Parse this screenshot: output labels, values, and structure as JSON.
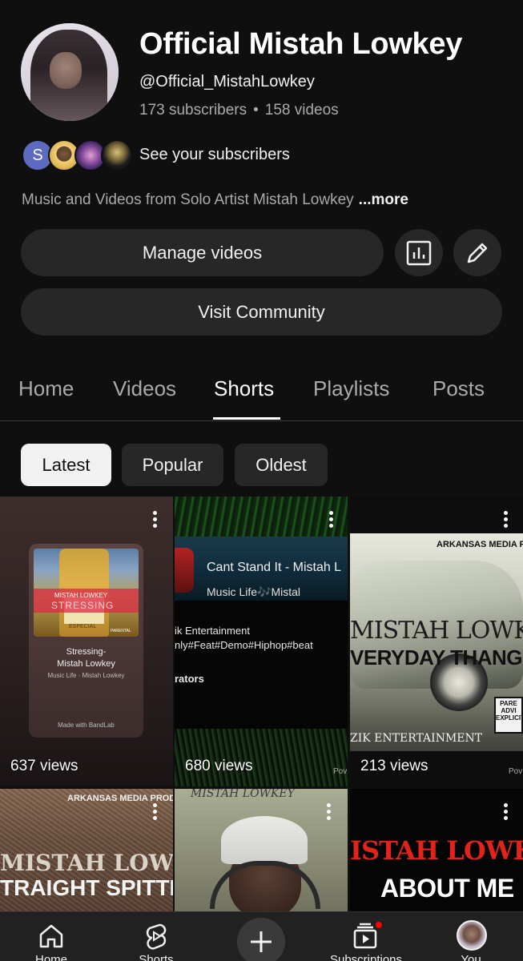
{
  "channel": {
    "name": "Official Mistah Lowkey",
    "handle": "@Official_MistahLowkey",
    "subscribers": "173 subscribers",
    "separator": "•",
    "videos": "158 videos",
    "see_subscribers": "See your subscribers",
    "subscriber_initial": "S",
    "description": "Music and Videos from Solo Artist Mistah Lowkey",
    "more": "...more"
  },
  "buttons": {
    "manage_videos": "Manage videos",
    "visit_community": "Visit Community"
  },
  "tabs": [
    {
      "label": "Home",
      "active": false
    },
    {
      "label": "Videos",
      "active": false
    },
    {
      "label": "Shorts",
      "active": true
    },
    {
      "label": "Playlists",
      "active": false
    },
    {
      "label": "Posts",
      "active": false
    }
  ],
  "chips": [
    {
      "label": "Latest",
      "active": true
    },
    {
      "label": "Popular",
      "active": false
    },
    {
      "label": "Oldest",
      "active": false
    }
  ],
  "shorts": [
    {
      "views": "637 views",
      "thumb_text": {
        "band_top": "MISTAH LOWKEY",
        "band_main": "STRESSING",
        "bottle_label": "ESPECIAL",
        "title_1": "Stressing-",
        "title_2": "Mistah Lowkey",
        "meta": "Music Life  ·  Mistah Lowkey",
        "footer": "Made with  BandLab",
        "parental": "PARENTAL"
      }
    },
    {
      "views": "680 views",
      "thumb_text": {
        "song": "Cant Stand It - Mistah L",
        "meta": "Music Life🎶Mistal",
        "line1": "ik Entertainment",
        "line2": "nly#Feat#Demo#Hiphop#beat",
        "line3": "rators",
        "pow": "Pov"
      }
    },
    {
      "views": "213 views",
      "thumb_text": {
        "header": "ARKANSAS MEDIA PRO",
        "big1": "MISTAH LOWKEY",
        "big2": "VERYDAY THANG",
        "label": "ZIK ENTERTAINMENT",
        "parental": "PARE ADVI EXPLICIT",
        "pow": "Pov"
      }
    },
    {
      "views": "",
      "thumb_text": {
        "header": "ARKANSAS MEDIA PRODUC",
        "big1": "MISTAH LOWKE",
        "big2": "TRAIGHT SPITTI"
      }
    },
    {
      "views": "",
      "thumb_text": {
        "header": "MISTAH LOWKEY"
      }
    },
    {
      "views": "",
      "thumb_text": {
        "big1": "ISTAH LOWKEY",
        "big2": "ABOUT ME"
      }
    }
  ],
  "bottom_nav": [
    {
      "label": "Home",
      "icon": "home-icon"
    },
    {
      "label": "Shorts",
      "icon": "shorts-icon"
    },
    {
      "label": "",
      "icon": "plus-icon"
    },
    {
      "label": "Subscriptions",
      "icon": "subscriptions-icon"
    },
    {
      "label": "You",
      "icon": "avatar"
    }
  ],
  "colors": {
    "background": "#0f0f0f",
    "surface": "#272727",
    "text_primary": "#f1f1f1",
    "text_secondary": "#aaaaaa",
    "notification": "#ff0000"
  }
}
